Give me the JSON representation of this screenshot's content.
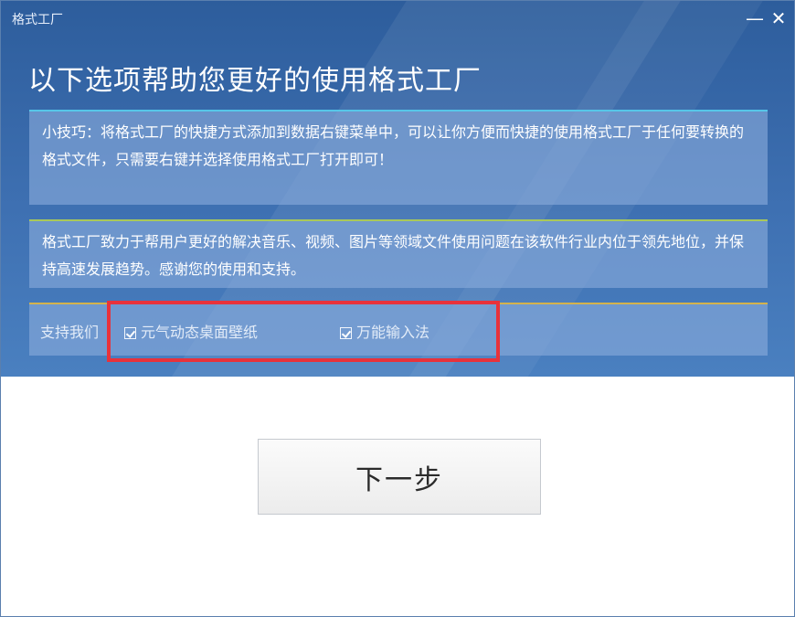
{
  "window": {
    "title": "格式工厂",
    "minimize_glyph": "—",
    "close_glyph": "✕"
  },
  "heading": "以下选项帮助您更好的使用格式工厂",
  "tip_panel": {
    "text": "小技巧：将格式工厂的快捷方式添加到数据右键菜单中，可以让你方便而快捷的使用格式工厂于任何要转换的格式文件，只需要右键并选择使用格式工厂打开即可！"
  },
  "about_panel": {
    "text": "格式工厂致力于帮用户更好的解决音乐、视频、图片等领域文件使用问题在该软件行业内位于领先地位，并保持高速发展趋势。感谢您的使用和支持。"
  },
  "support": {
    "label": "支持我们",
    "options": [
      {
        "label": "元气动态桌面壁纸",
        "checked": true
      },
      {
        "label": "万能输入法",
        "checked": true
      }
    ]
  },
  "next_button": {
    "label": "下一步"
  },
  "colors": {
    "header_blue": "#3e70b2",
    "highlight_red": "#e8323b",
    "tip_accent": "#56c6e8",
    "about_accent": "#a9c85a",
    "support_accent": "#d4b24c"
  }
}
